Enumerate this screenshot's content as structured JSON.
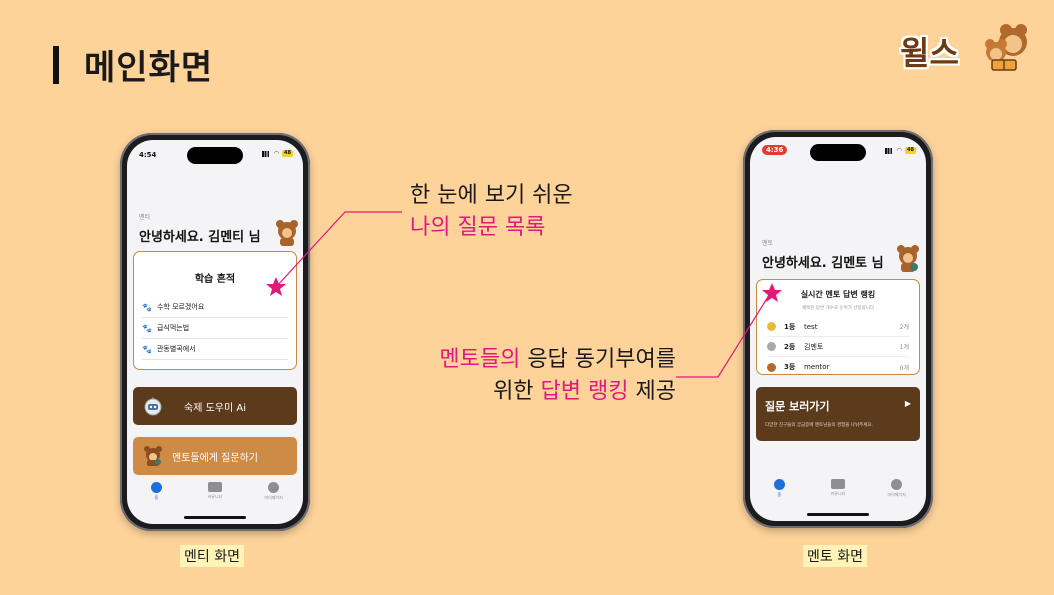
{
  "slide": {
    "title": "메인화면"
  },
  "logo": {
    "text": "윌스"
  },
  "left_phone": {
    "status": {
      "time": "4:54",
      "battery": "48"
    },
    "role": "멘티",
    "greeting": "안녕하세요. 김멘티 님",
    "history": {
      "title": "학습 흔적",
      "items": [
        "수학 모르겠어요",
        "급식먹는법",
        "관동별곡에서"
      ]
    },
    "homework_button": "숙제 도우미 Ai",
    "ask_button": "멘토들에게 질문하기",
    "tabs": [
      "홈",
      "커뮤니티",
      "마이페이지"
    ]
  },
  "right_phone": {
    "status": {
      "time": "4:36",
      "battery": "48"
    },
    "role": "멘토",
    "greeting": "안녕하세요. 김멘토 님",
    "ranking": {
      "title": "실시간 멘토 답변 랭킹",
      "subtitle": "채택된 답변 개수로 순위가 산정됩니다",
      "rows": [
        {
          "rank": "1등",
          "name": "test",
          "count": "2개",
          "medal_color": "#e9b93a"
        },
        {
          "rank": "2등",
          "name": "김멘토",
          "count": "1개",
          "medal_color": "#a9a9ad"
        },
        {
          "rank": "3등",
          "name": "mentor",
          "count": "0개",
          "medal_color": "#b26b2f"
        }
      ]
    },
    "question_card": {
      "title": "질문 보러가기",
      "arrow": "▶",
      "description": "다양한 친구들의 궁금증에 멘토님들의 경험을 나눠주세요."
    },
    "tabs": [
      "홈",
      "커뮤니티",
      "마이페이지"
    ]
  },
  "callouts": {
    "top": {
      "line1": "한 눈에 보기 쉬운",
      "line2": "나의 질문 목록"
    },
    "bottom": {
      "l1_pink": "멘토들의",
      "l1_rest": " 응답 동기부여를",
      "l2_pre": "위한 ",
      "l2_pink": "답변 랭킹",
      "l2_post": " 제공"
    }
  },
  "captions": {
    "left": "멘티 화면",
    "right": "멘토 화면"
  },
  "colors": {
    "background": "#fdd39a",
    "accent_pink": "#e0197d",
    "brown_dark": "#5c3a1c",
    "brown_light": "#cd8b45"
  }
}
